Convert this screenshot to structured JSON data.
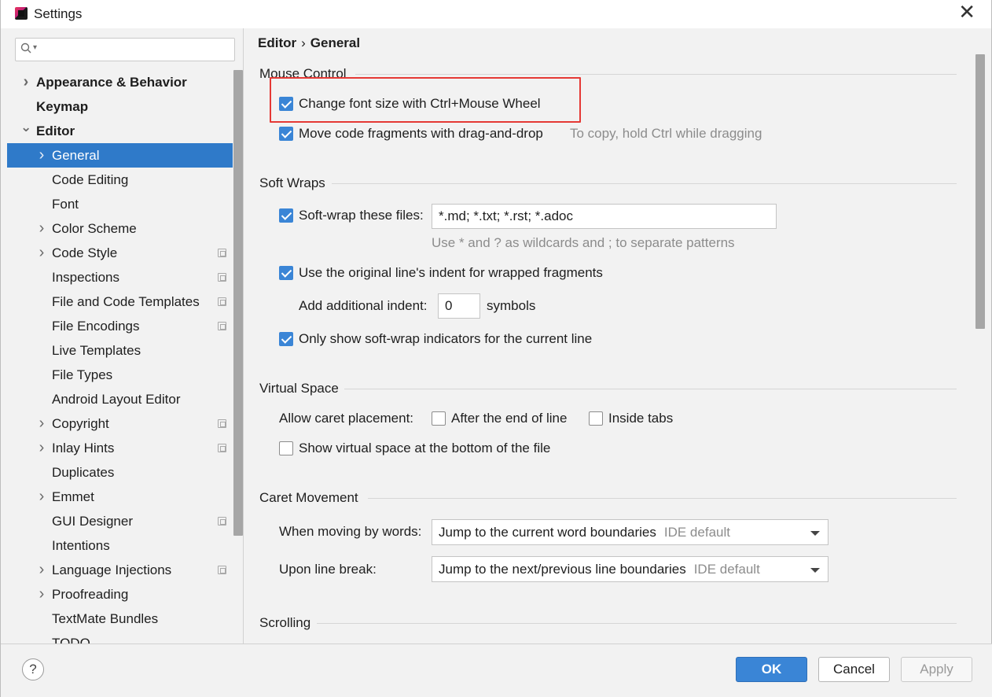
{
  "window": {
    "title": "Settings"
  },
  "search": {
    "placeholder": ""
  },
  "sidebar": {
    "items": [
      {
        "label": "Appearance & Behavior",
        "bold": true,
        "arrow": true,
        "level": 0
      },
      {
        "label": "Keymap",
        "bold": true,
        "arrow": false,
        "level": 0
      },
      {
        "label": "Editor",
        "bold": true,
        "arrow": "down",
        "level": 0
      },
      {
        "label": "General",
        "selected": true,
        "arrow": true,
        "level": 1
      },
      {
        "label": "Code Editing",
        "level": 1
      },
      {
        "label": "Font",
        "level": 1
      },
      {
        "label": "Color Scheme",
        "arrow": true,
        "level": 1
      },
      {
        "label": "Code Style",
        "arrow": true,
        "level": 1,
        "project": true
      },
      {
        "label": "Inspections",
        "level": 1,
        "project": true
      },
      {
        "label": "File and Code Templates",
        "level": 1,
        "project": true
      },
      {
        "label": "File Encodings",
        "level": 1,
        "project": true
      },
      {
        "label": "Live Templates",
        "level": 1
      },
      {
        "label": "File Types",
        "level": 1
      },
      {
        "label": "Android Layout Editor",
        "level": 1
      },
      {
        "label": "Copyright",
        "arrow": true,
        "level": 1,
        "project": true
      },
      {
        "label": "Inlay Hints",
        "arrow": true,
        "level": 1,
        "project": true
      },
      {
        "label": "Duplicates",
        "level": 1
      },
      {
        "label": "Emmet",
        "arrow": true,
        "level": 1
      },
      {
        "label": "GUI Designer",
        "level": 1,
        "project": true
      },
      {
        "label": "Intentions",
        "level": 1
      },
      {
        "label": "Language Injections",
        "arrow": true,
        "level": 1,
        "project": true
      },
      {
        "label": "Proofreading",
        "arrow": true,
        "level": 1
      },
      {
        "label": "TextMate Bundles",
        "level": 1
      },
      {
        "label": "TODO",
        "level": 1
      }
    ]
  },
  "breadcrumb": {
    "parent": "Editor",
    "separator": "›",
    "current": "General"
  },
  "mouse_control": {
    "title": "Mouse Control",
    "font_size_wheel": {
      "label": "Change font size with Ctrl+Mouse Wheel",
      "checked": true
    },
    "drag_drop": {
      "label": "Move code fragments with drag-and-drop",
      "checked": true,
      "hint": "To copy, hold Ctrl while dragging"
    }
  },
  "soft_wraps": {
    "title": "Soft Wraps",
    "soft_wrap_files": {
      "label": "Soft-wrap these files:",
      "checked": true,
      "value": "*.md; *.txt; *.rst; *.adoc",
      "hint": "Use * and ? as wildcards and ; to separate patterns"
    },
    "original_indent": {
      "label": "Use the original line's indent for wrapped fragments",
      "checked": true
    },
    "additional_indent": {
      "label": "Add additional indent:",
      "value": "0",
      "unit": "symbols"
    },
    "indicators_current_line": {
      "label": "Only show soft-wrap indicators for the current line",
      "checked": true
    }
  },
  "virtual_space": {
    "title": "Virtual Space",
    "caret_placement_label": "Allow caret placement:",
    "after_end_of_line": {
      "label": "After the end of line",
      "checked": false
    },
    "inside_tabs": {
      "label": "Inside tabs",
      "checked": false
    },
    "virtual_space_bottom": {
      "label": "Show virtual space at the bottom of the file",
      "checked": false
    }
  },
  "caret_movement": {
    "title": "Caret Movement",
    "by_words": {
      "label": "When moving by words:",
      "value": "Jump to the current word boundaries",
      "note": "IDE default"
    },
    "line_break": {
      "label": "Upon line break:",
      "value": "Jump to the next/previous line boundaries",
      "note": "IDE default"
    }
  },
  "scrolling": {
    "title": "Scrolling"
  },
  "footer": {
    "help": "?",
    "ok": "OK",
    "cancel": "Cancel",
    "apply": "Apply"
  },
  "colors": {
    "accent": "#3a85d6",
    "selected": "#2f7ac9",
    "highlight_box": "#e53935"
  }
}
